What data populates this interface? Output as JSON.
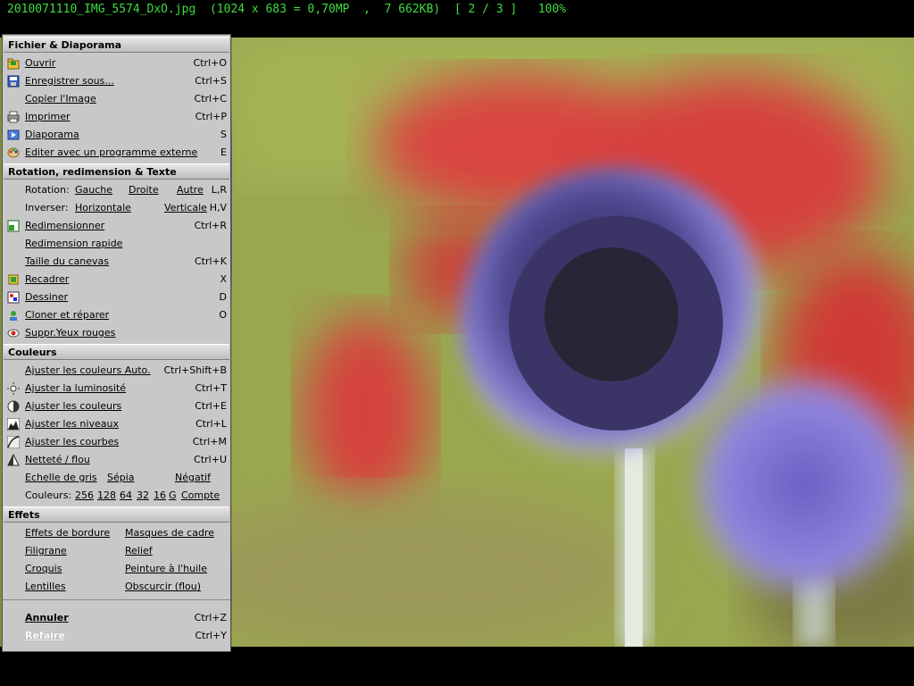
{
  "title": "2010071110_IMG_5574_DxO.jpg  (1024 x 683 = 0,70MP  ,  7 662KB)  [ 2 / 3 ]   100%",
  "colors": {
    "title_green": "#3fdc3f",
    "menu_bg": "#c8c8c8"
  },
  "menu": {
    "file": {
      "header": "Fichier & Diaporama",
      "items": [
        {
          "label": "Ouvrir",
          "shortcut": "Ctrl+O",
          "icon": "folder-open-icon"
        },
        {
          "label": "Enregistrer sous...",
          "shortcut": "Ctrl+S",
          "icon": "floppy-icon"
        },
        {
          "label": "Copier l'Image",
          "shortcut": "Ctrl+C",
          "icon": ""
        },
        {
          "label": "Imprimer",
          "shortcut": "Ctrl+P",
          "icon": "printer-icon"
        },
        {
          "label": "Diaporama",
          "shortcut": "S",
          "icon": "slideshow-icon"
        },
        {
          "label": "Editer avec un programme externe",
          "shortcut": "E",
          "icon": "palette-icon"
        }
      ]
    },
    "rotation": {
      "header": "Rotation, redimension & Texte",
      "rotation_label": "Rotation:",
      "rotation_left": "Gauche",
      "rotation_right": "Droite",
      "rotation_other": "Autre",
      "rotation_sc": "L,R",
      "invert_label": "Inverser:",
      "invert_h": "Horizontale",
      "invert_v": "Verticale",
      "invert_sc": "H,V",
      "items": [
        {
          "label": "Redimensionner",
          "shortcut": "Ctrl+R",
          "icon": "resize-icon"
        },
        {
          "label": "Redimension rapide",
          "shortcut": "",
          "icon": ""
        },
        {
          "label": "Taille du canevas",
          "shortcut": "Ctrl+K",
          "icon": ""
        },
        {
          "label": "Recadrer",
          "shortcut": "X",
          "icon": "crop-icon"
        },
        {
          "label": "Dessiner",
          "shortcut": "D",
          "icon": "draw-icon"
        },
        {
          "label": "Cloner et réparer",
          "shortcut": "O",
          "icon": "clone-icon"
        },
        {
          "label": "Suppr.Yeux rouges",
          "shortcut": "",
          "icon": "red-eye-icon"
        }
      ]
    },
    "colors_sec": {
      "header": "Couleurs",
      "items": [
        {
          "label": "Ajuster les couleurs Auto.",
          "shortcut": "Ctrl+Shift+B",
          "icon": ""
        },
        {
          "label": "Ajuster la luminosité",
          "shortcut": "Ctrl+T",
          "icon": "brightness-icon"
        },
        {
          "label": "Ajuster les couleurs",
          "shortcut": "Ctrl+E",
          "icon": "color-balance-icon"
        },
        {
          "label": "Ajuster les niveaux",
          "shortcut": "Ctrl+L",
          "icon": "levels-icon"
        },
        {
          "label": "Ajuster les courbes",
          "shortcut": "Ctrl+M",
          "icon": "curves-icon"
        },
        {
          "label": "Netteté / flou",
          "shortcut": "Ctrl+U",
          "icon": "sharpen-icon"
        }
      ],
      "grey": "Echelle de gris",
      "sepia": "Sépia",
      "negative": "Négatif",
      "colors_label": "Couleurs:",
      "c256": "256",
      "c128": "128",
      "c64": "64",
      "c32": "32",
      "c16": "16",
      "cg": "G",
      "count": "Compte"
    },
    "effects": {
      "header": "Effets",
      "border": "Effets de bordure",
      "frame": "Masques de cadre",
      "watermark": "Filigrane",
      "relief": "Relief",
      "sketch": "Croquis",
      "oil": "Peinture à l'huile",
      "lens": "Lentilles",
      "blur": "Obscurcir (flou)"
    },
    "undo": "Annuler",
    "undo_sc": "Ctrl+Z",
    "redo": "Refaire",
    "redo_sc": "Ctrl+Y"
  }
}
